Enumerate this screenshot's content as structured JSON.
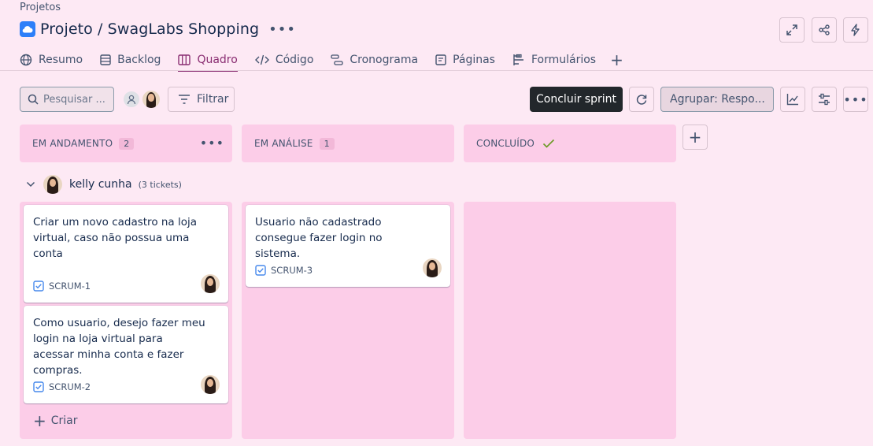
{
  "breadcrumb": "Projetos",
  "title": "Projeto / SwagLabs Shopping",
  "tabs": [
    {
      "label": "Resumo",
      "icon": "globe-icon"
    },
    {
      "label": "Backlog",
      "icon": "list-icon"
    },
    {
      "label": "Quadro",
      "icon": "board-icon",
      "active": true
    },
    {
      "label": "Código",
      "icon": "code-icon"
    },
    {
      "label": "Cronograma",
      "icon": "timeline-icon"
    },
    {
      "label": "Páginas",
      "icon": "page-icon"
    },
    {
      "label": "Formulários",
      "icon": "form-icon"
    }
  ],
  "toolbar": {
    "search_placeholder": "Pesquisar ...",
    "filter_label": "Filtrar",
    "complete_sprint_label": "Concluir sprint",
    "group_label": "Agrupar: Respo..."
  },
  "columns": [
    {
      "title": "EM ANDAMENTO",
      "count": "2"
    },
    {
      "title": "EM ANÁLISE",
      "count": "1"
    },
    {
      "title": "CONCLUÍDO",
      "count": ""
    }
  ],
  "swimlane": {
    "name": "kelly cunha",
    "count": "(3 tickets)"
  },
  "cards": [
    {
      "title": "Criar um novo cadastro na loja virtual, caso não possua uma conta",
      "key": "SCRUM-1"
    },
    {
      "title": "Como usuario, desejo fazer meu login na loja virtual para acessar minha conta e fazer compras.",
      "key": "SCRUM-2"
    },
    {
      "title": "Usuario não cadastrado consegue fazer login no sistema.",
      "key": "SCRUM-3"
    }
  ],
  "create_label": "Criar",
  "colors": {
    "accent": "#8a2e72",
    "column_bg": "#fccde8",
    "page_bg": "#fde9f4",
    "check_green": "#6a9a23",
    "task_blue": "#4688ec"
  }
}
